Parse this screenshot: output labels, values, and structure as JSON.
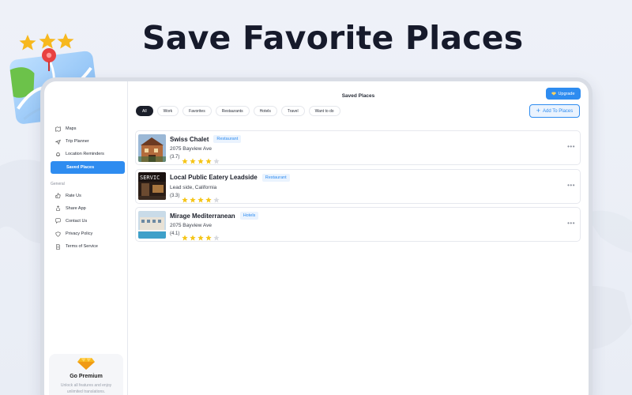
{
  "headline": "Save Favorite Places",
  "window": {
    "title": "Saved Places",
    "upgrade_label": "Upgrade",
    "add_places_label": "Add To Places"
  },
  "sidebar": {
    "items": [
      {
        "label": "Maps",
        "icon": "map-icon"
      },
      {
        "label": "Trip Planner",
        "icon": "plane-icon"
      },
      {
        "label": "Location Reminders",
        "icon": "bell-icon"
      },
      {
        "label": "Saved Places",
        "icon": "bookmark-icon",
        "active": true
      }
    ],
    "general_label": "General",
    "general_items": [
      {
        "label": "Rate Us",
        "icon": "thumbs-up-icon"
      },
      {
        "label": "Share App",
        "icon": "share-icon"
      },
      {
        "label": "Contact Us",
        "icon": "chat-icon"
      },
      {
        "label": "Privacy Policy",
        "icon": "shield-icon"
      },
      {
        "label": "Terms of Service",
        "icon": "document-icon"
      }
    ],
    "premium": {
      "title": "Go Premium",
      "description": "Unlock all features and enjoy unlimited translations."
    }
  },
  "filters": [
    "All",
    "Work",
    "Favorites",
    "Restaurants",
    "Hotels",
    "Travel",
    "Want to do"
  ],
  "active_filter": "All",
  "places": [
    {
      "name": "Swiss Chalet",
      "tag": "Restaurant",
      "address": "2075 Bayview Ave",
      "rating_text": "(3.7)",
      "stars": 4
    },
    {
      "name": "Local Public Eatery Leadside",
      "tag": "Restaurant",
      "address": "Lead side, California",
      "rating_text": "(3.3)",
      "stars": 4
    },
    {
      "name": "Mirage Mediterranean",
      "tag": "Hotels",
      "address": "2075 Bayview Ave",
      "rating_text": "(4.1)",
      "stars": 4
    }
  ],
  "thumb_text": "SERVIC",
  "colors": {
    "accent": "#2e8cf0",
    "star": "#f5c518",
    "star_empty": "#d7d9de",
    "headline": "#161a2b"
  }
}
